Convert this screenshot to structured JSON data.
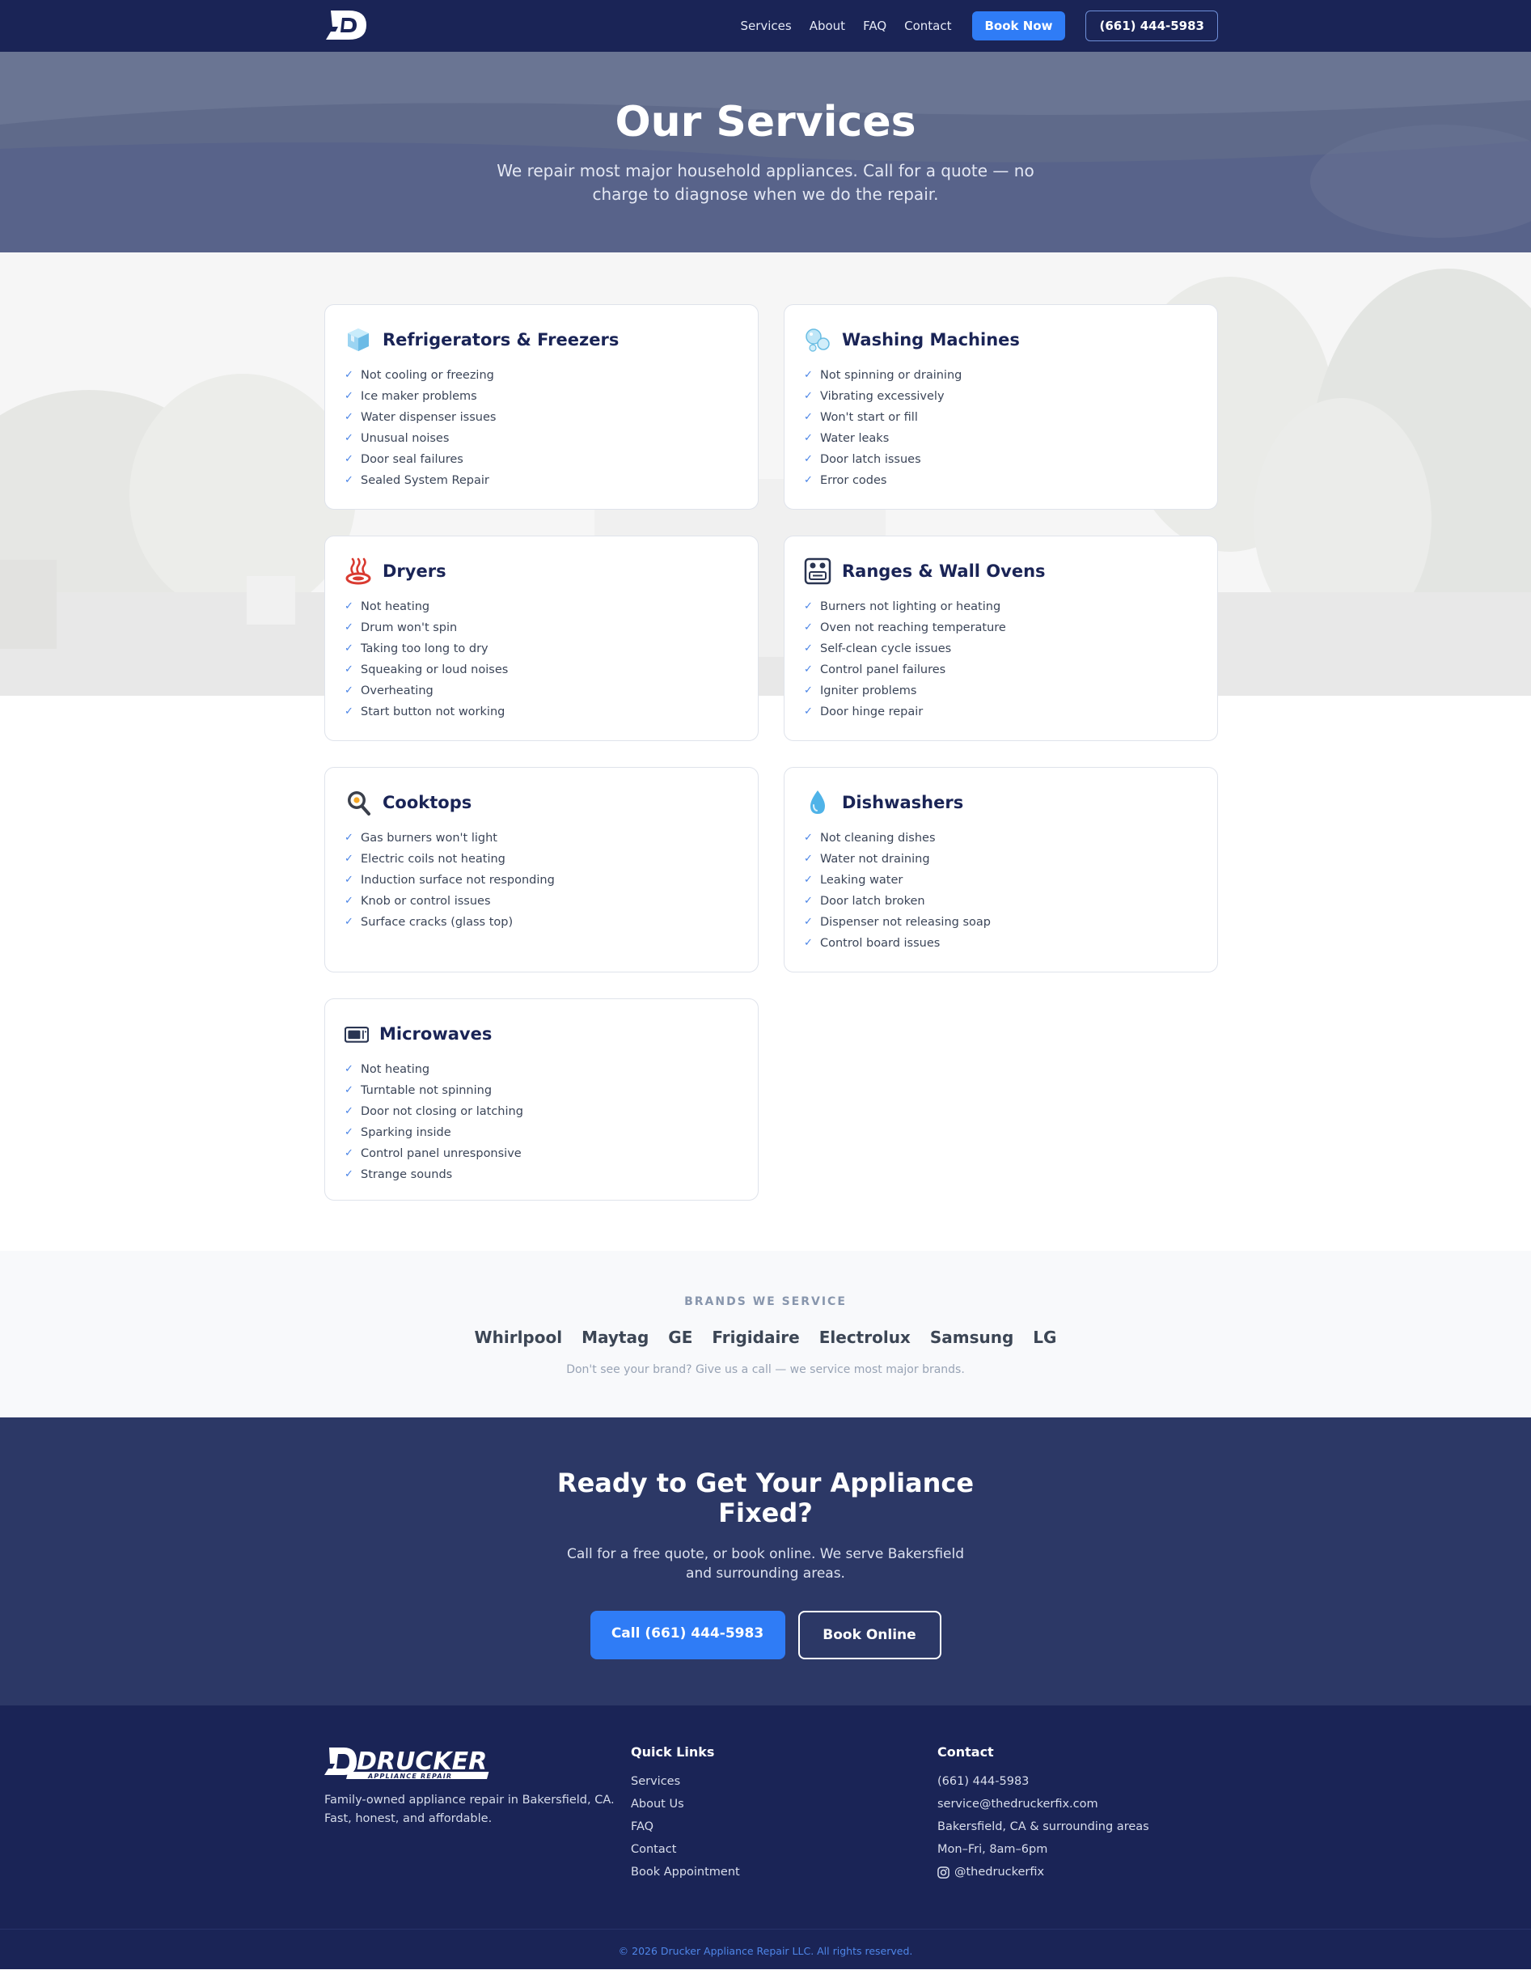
{
  "nav": {
    "links": [
      "Services",
      "About",
      "FAQ",
      "Contact"
    ],
    "book_label": "Book Now",
    "phone_label": "(661) 444-5983"
  },
  "hero": {
    "title": "Our Services",
    "subtitle": "We repair most major household appliances. Call for a quote — no charge to diagnose when we do the repair."
  },
  "services": [
    {
      "icon": "ice-cube-icon",
      "title": "Refrigerators & Freezers",
      "items": [
        "Not cooling or freezing",
        "Ice maker problems",
        "Water dispenser issues",
        "Unusual noises",
        "Door seal failures",
        "Sealed System Repair"
      ]
    },
    {
      "icon": "bubbles-icon",
      "title": "Washing Machines",
      "items": [
        "Not spinning or draining",
        "Vibrating excessively",
        "Won't start or fill",
        "Water leaks",
        "Door latch issues",
        "Error codes"
      ]
    },
    {
      "icon": "hot-springs-icon",
      "title": "Dryers",
      "items": [
        "Not heating",
        "Drum won't spin",
        "Taking too long to dry",
        "Squeaking or loud noises",
        "Overheating",
        "Start button not working"
      ]
    },
    {
      "icon": "oven-icon",
      "title": "Ranges & Wall Ovens",
      "items": [
        "Burners not lighting or heating",
        "Oven not reaching temperature",
        "Self-clean cycle issues",
        "Control panel failures",
        "Igniter problems",
        "Door hinge repair"
      ]
    },
    {
      "icon": "frying-pan-icon",
      "title": "Cooktops",
      "items": [
        "Gas burners won't light",
        "Electric coils not heating",
        "Induction surface not responding",
        "Knob or control issues",
        "Surface cracks (glass top)"
      ]
    },
    {
      "icon": "droplet-icon",
      "title": "Dishwashers",
      "items": [
        "Not cleaning dishes",
        "Water not draining",
        "Leaking water",
        "Door latch broken",
        "Dispenser not releasing soap",
        "Control board issues"
      ]
    },
    {
      "icon": "microwave-icon",
      "title": "Microwaves",
      "items": [
        "Not heating",
        "Turntable not spinning",
        "Door not closing or latching",
        "Sparking inside",
        "Control panel unresponsive",
        "Strange sounds"
      ]
    }
  ],
  "brands": {
    "label": "BRANDS WE SERVICE",
    "list": [
      "Whirlpool",
      "Maytag",
      "GE",
      "Frigidaire",
      "Electrolux",
      "Samsung",
      "LG"
    ],
    "note": "Don't see your brand? Give us a call — we service most major brands."
  },
  "cta": {
    "title": "Ready to Get Your Appliance Fixed?",
    "text": "Call for a free quote, or book online. We serve Bakersfield and surrounding areas.",
    "call_label": "Call (661) 444-5983",
    "book_label": "Book Online"
  },
  "footer": {
    "logo_text": "DRUCKER",
    "logo_subtext": "APPLIANCE REPAIR",
    "tagline": "Family-owned appliance repair in Bakersfield, CA. Fast, honest, and affordable.",
    "quick_links_title": "Quick Links",
    "quick_links": [
      "Services",
      "About Us",
      "FAQ",
      "Contact",
      "Book Appointment"
    ],
    "contact_title": "Contact",
    "contact_lines": [
      "(661) 444-5983",
      "service@thedruckerfix.com",
      "Bakersfield, CA & surrounding areas",
      "Mon–Fri, 8am–6pm"
    ],
    "social_handle": "@thedruckerfix",
    "copyright": "© 2026 Drucker Appliance Repair LLC. All rights reserved."
  },
  "colors": {
    "navy": "#1a2456",
    "accent_blue": "#2f7cf6",
    "cta_bg": "#2c3866",
    "check": "#4a84e6"
  }
}
